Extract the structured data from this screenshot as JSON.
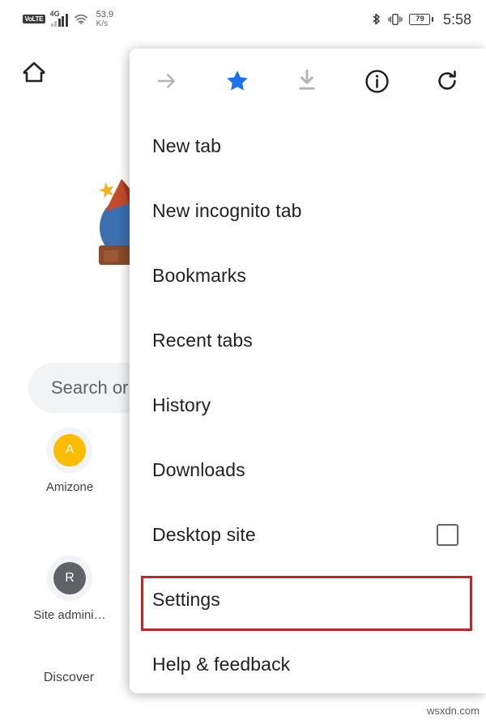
{
  "status_bar": {
    "volte_label": "VoLTE",
    "network_type": "4G",
    "signal_bars": 5,
    "wifi_icon": "wifi-icon",
    "data_speed_value": "53.9",
    "data_speed_unit": "K/s",
    "bluetooth_icon": "bluetooth-icon",
    "vibrate_icon": "vibrate-icon",
    "battery_percent": "79",
    "time": "5:58"
  },
  "page": {
    "home_icon": "home-icon",
    "doodle_alt": "google-doodle-illustration",
    "search": {
      "placeholder": "Search or",
      "icon": "search-placeholder-text"
    },
    "shortcuts": [
      {
        "initial": "A",
        "label": "Amizone",
        "color": "#fbbc04"
      },
      {
        "initial": "R",
        "label": "Site admini…",
        "color": "#5f6368"
      }
    ],
    "discover_label": "Discover"
  },
  "menu": {
    "header_icons": [
      {
        "name": "forward-arrow-icon",
        "label": "Forward",
        "state": "disabled",
        "color": "#b5b5b5"
      },
      {
        "name": "bookmark-star-icon",
        "label": "Bookmark",
        "state": "active",
        "color": "#1a73e8"
      },
      {
        "name": "download-icon",
        "label": "Download",
        "state": "disabled",
        "color": "#b5b5b5"
      },
      {
        "name": "page-info-icon",
        "label": "Page info",
        "state": "enabled",
        "color": "#202124"
      },
      {
        "name": "reload-icon",
        "label": "Reload",
        "state": "enabled",
        "color": "#202124"
      }
    ],
    "items": [
      {
        "label": "New tab",
        "type": "item"
      },
      {
        "label": "New incognito tab",
        "type": "item"
      },
      {
        "label": "Bookmarks",
        "type": "item"
      },
      {
        "label": "Recent tabs",
        "type": "item"
      },
      {
        "label": "History",
        "type": "item"
      },
      {
        "label": "Downloads",
        "type": "item"
      },
      {
        "label": "Desktop site",
        "type": "checkbox",
        "checked": false,
        "highlighted": true
      },
      {
        "label": "Settings",
        "type": "item"
      },
      {
        "label": "Help & feedback",
        "type": "item"
      }
    ]
  },
  "annotation": {
    "highlight_color": "#c0272d",
    "target_label": "Desktop site"
  },
  "watermark": {
    "text": "wsxdn.com"
  }
}
